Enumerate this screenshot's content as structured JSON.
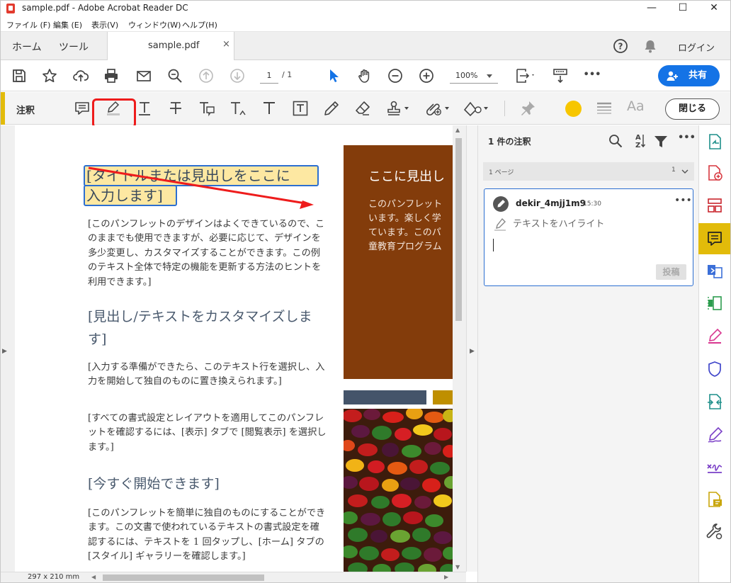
{
  "window": {
    "title": "sample.pdf - Adobe Acrobat Reader DC",
    "minimize": "—",
    "maximize": "☐",
    "close": "✕"
  },
  "menu": [
    "ファイル (F)",
    "編集 (E)",
    "表示(V)",
    "ウィンドウ(W)",
    "ヘルプ(H)"
  ],
  "tabs": {
    "home": "ホーム",
    "tools": "ツール",
    "document": "sample.pdf",
    "close": "×",
    "login": "ログイン"
  },
  "toolbar": {
    "page_current": "1",
    "page_total": "/ 1",
    "zoom": "100%",
    "share_label": "共有",
    "more": "•••"
  },
  "annotation_bar": {
    "label": "注釈",
    "close_label": "閉じる",
    "text_style_label": "Aa",
    "highlight_color": "#f7c600",
    "accent_color": "#e2bb0a"
  },
  "page": {
    "title_line1": "[タイトルまたは見出しをここに",
    "title_line2": "入力します]",
    "para1": "[このパンフレットのデザインはよくできているので、このままでも使用できますが、必要に応じて、デザインを多少変更し、カスタマイズすることができます。この例のテキスト全体で特定の機能を更新する方法のヒントを利用できます。]",
    "heading2": "[見出し/テキストをカスタマイズします]",
    "para2": "[入力する準備ができたら、このテキスト行を選択し、入力を開始して独自のものに置き換えられます。]",
    "para3": "[すべての書式設定とレイアウトを適用してこのパンフレットを確認するには、[表示] タブで [閲覧表示] を選択します。]",
    "heading3": "[今すぐ開始できます]",
    "para4": "[このパンフレットを簡単に独自のものにすることができます。この文書で使われているテキストの書式設定を確認するには、テキストを 1 回タップし、[ホーム] タブの [スタイル] ギャラリーを確認します。]",
    "sidebar_heading": "ここに見出し",
    "sidebar_lines": [
      "このパンフレット",
      "います。楽しく学",
      "ています。このパ",
      "童教育プログラム"
    ],
    "page_size": "297 x 210 mm"
  },
  "comments": {
    "count_label": "1 件の注釈",
    "page_group": "1 ページ",
    "page_group_count": "1",
    "user": "dekir_4mjj1m9",
    "time": "15:30",
    "type": "テキストをハイライト",
    "post_label": "投稿",
    "more": "•••"
  }
}
